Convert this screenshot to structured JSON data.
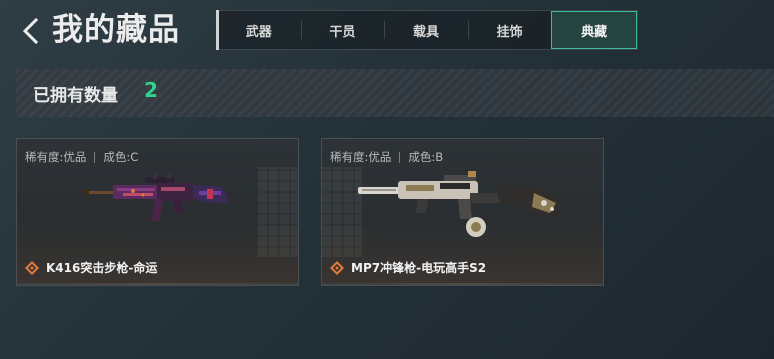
{
  "header": {
    "back_icon": "chevron-left-icon",
    "title": "我的藏品"
  },
  "tabs": [
    {
      "label": "武器",
      "active": false
    },
    {
      "label": "干员",
      "active": false
    },
    {
      "label": "载具",
      "active": false
    },
    {
      "label": "挂饰",
      "active": false
    },
    {
      "label": "典藏",
      "active": true
    }
  ],
  "summary": {
    "owned_label": "已拥有数量",
    "owned_count": "2"
  },
  "items": [
    {
      "rarity": "稀有度:优品",
      "condition": "成色:C",
      "name": "K416突击步枪-命运",
      "image": "k416-rifle-purple-skin",
      "rarity_icon": "diamond-rarity-icon"
    },
    {
      "rarity": "稀有度:优品",
      "condition": "成色:B",
      "name": "MP7冲锋枪-电玩高手S2",
      "image": "mp7-smg-white-gold-skin",
      "rarity_icon": "diamond-rarity-icon"
    }
  ],
  "colors": {
    "accent_green": "#32d38c",
    "active_tab_border": "#3dbb96",
    "rarity_orange": "#e0793a"
  }
}
